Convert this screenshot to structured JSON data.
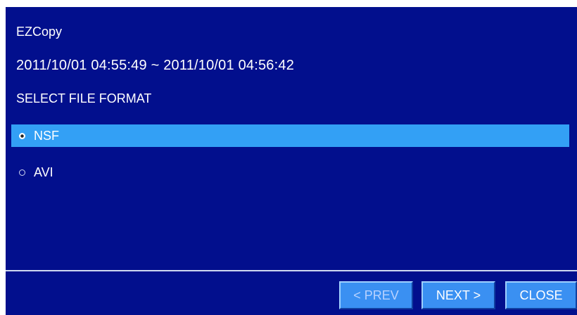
{
  "dialog": {
    "title": "EZCopy",
    "time_range": "2011/10/01 04:55:49 ~ 2011/10/01 04:56:42",
    "heading": "SELECT FILE FORMAT"
  },
  "options": [
    {
      "label": "NSF",
      "selected": true
    },
    {
      "label": "AVI",
      "selected": false
    }
  ],
  "buttons": {
    "prev": "< PREV",
    "next": "NEXT >",
    "close": "CLOSE",
    "prev_enabled": false
  },
  "colors": {
    "background": "#020f8d",
    "selection": "#33a0f5",
    "button": "#3a90f2"
  }
}
